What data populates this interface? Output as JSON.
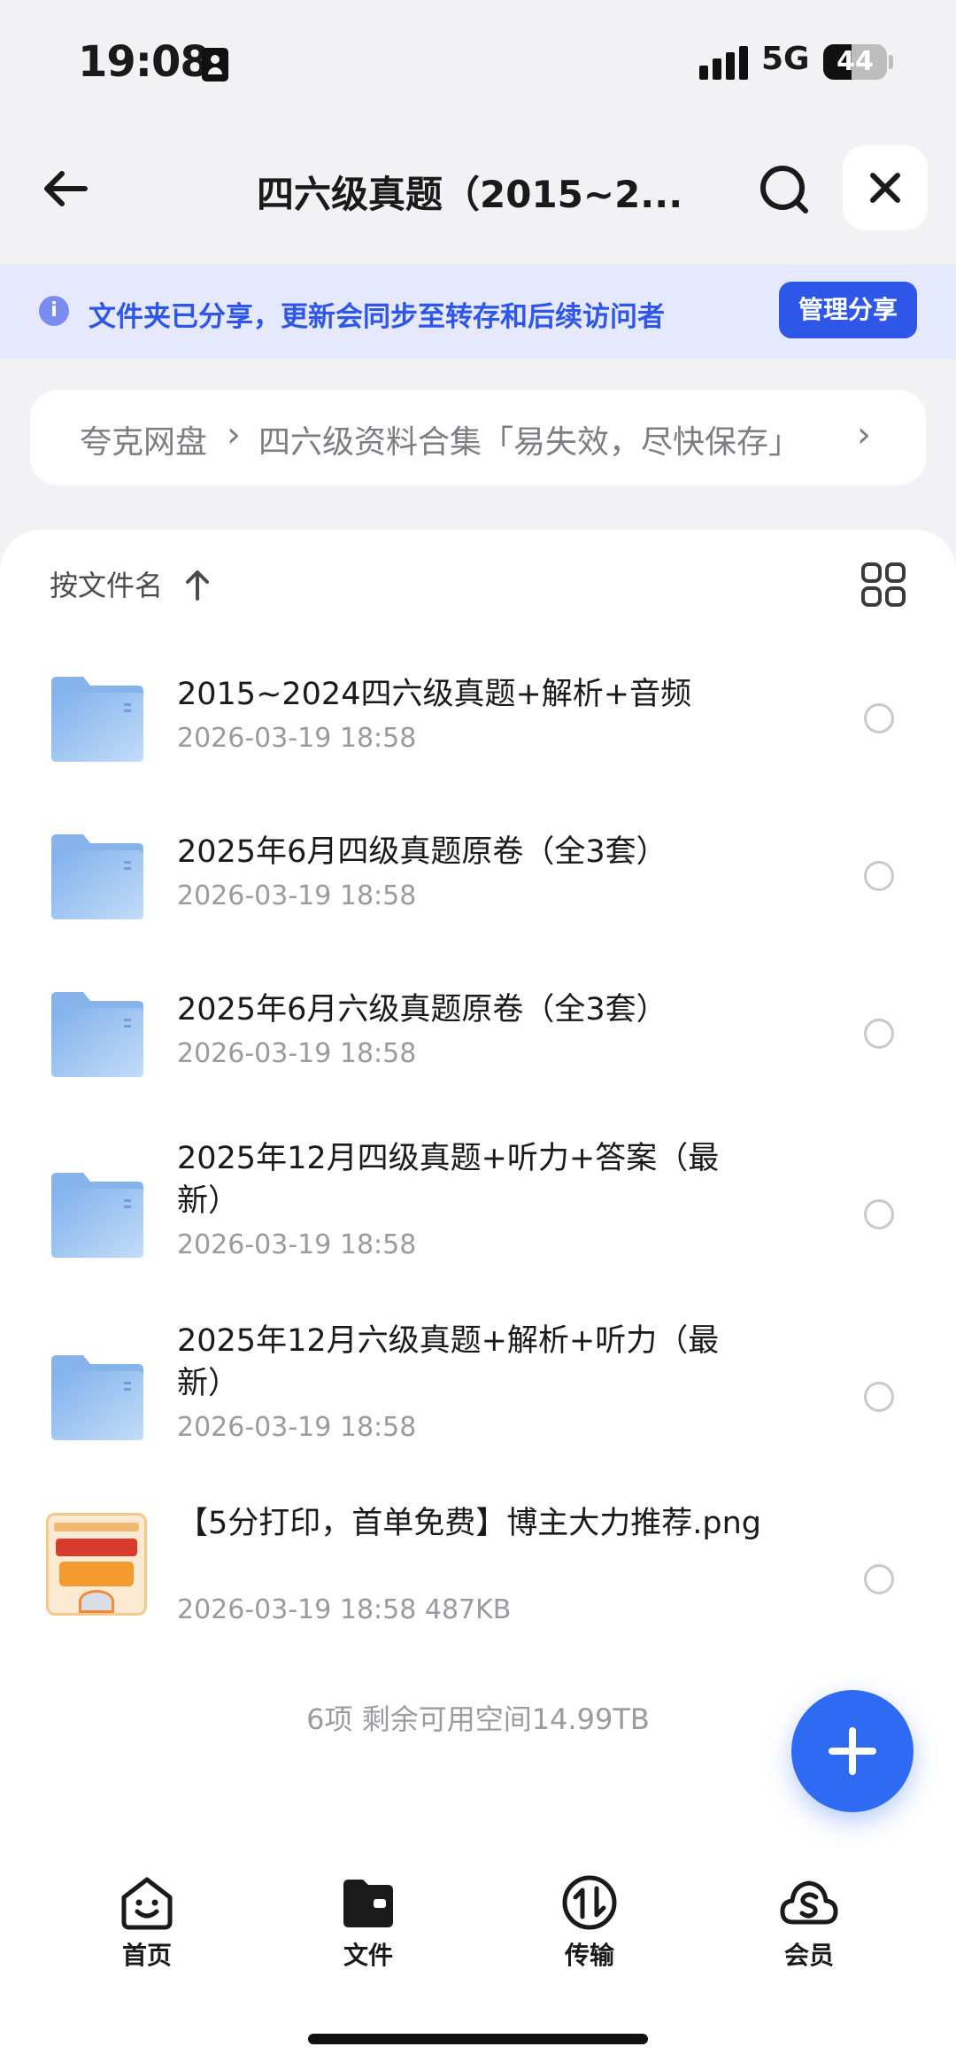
{
  "status_bar": {
    "time": "19:08",
    "network": "5G",
    "battery": "44",
    "battery_level": 0.44
  },
  "header": {
    "title": "四六级真题（2015~2..."
  },
  "share_banner": {
    "text": "文件夹已分享，更新会同步至转存和后续访问者",
    "button_label": "管理分享",
    "info_glyph": "i"
  },
  "breadcrumb": {
    "items": [
      "夸克网盘",
      "四六级资料合集「易失效，尽快保存」"
    ],
    "separator": "›"
  },
  "sort": {
    "label": "按文件名"
  },
  "files": [
    {
      "type": "folder",
      "name": "2015~2024四六级真题+解析+音频",
      "meta": "2026-03-19 18:58"
    },
    {
      "type": "folder",
      "name": "2025年6月四级真题原卷（全3套）",
      "meta": "2026-03-19 18:58"
    },
    {
      "type": "folder",
      "name": "2025年6月六级真题原卷（全3套）",
      "meta": "2026-03-19 18:58"
    },
    {
      "type": "folder",
      "name": "2025年12月四级真题+听力+答案（最新）",
      "meta": "2026-03-19 18:58"
    },
    {
      "type": "folder",
      "name": "2025年12月六级真题+解析+听力（最新）",
      "meta": "2026-03-19 18:58"
    },
    {
      "type": "image",
      "name": "【5分打印，首单免费】博主大力推荐.png",
      "meta": "2026-03-19 18:58  487KB"
    }
  ],
  "summary": "6项 剩余可用空间14.99TB",
  "bottom_nav": [
    {
      "label": "首页",
      "icon": "smile-home-icon"
    },
    {
      "label": "文件",
      "icon": "folder-wallet-icon"
    },
    {
      "label": "传输",
      "icon": "transfer-icon"
    },
    {
      "label": "会员",
      "icon": "cloud-vip-icon"
    }
  ],
  "colors": {
    "accent": "#2e57e8",
    "banner_bg": "#e6e9fd",
    "fab": "#2f6bf2",
    "folder": "#a6c9f3"
  }
}
